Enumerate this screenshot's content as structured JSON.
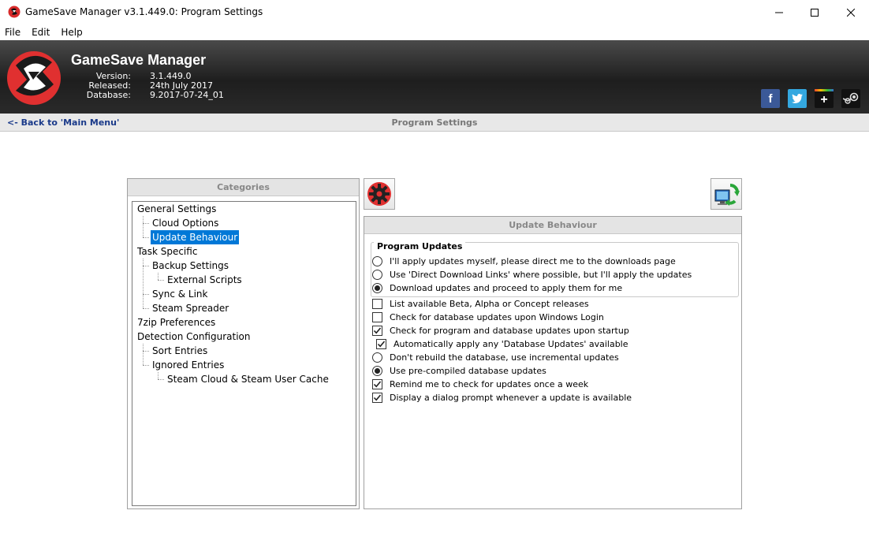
{
  "window": {
    "title": "GameSave Manager v3.1.449.0: Program Settings"
  },
  "menu": [
    "File",
    "Edit",
    "Help"
  ],
  "banner": {
    "app_name": "GameSave Manager",
    "labels": [
      "Version:",
      "Released:",
      "Database:"
    ],
    "values": [
      "3.1.449.0",
      "24th July 2017",
      "9.2017-07-24_01"
    ],
    "social": {
      "facebook": "f",
      "google_plus": "+"
    }
  },
  "nav": {
    "back_label": "<- Back to 'Main Menu'",
    "title": "Program Settings"
  },
  "categories": {
    "header": "Categories",
    "items": [
      "General Settings",
      "Cloud Options",
      "Update Behaviour",
      "Task Specific",
      "Backup Settings",
      "External Scripts",
      "Sync & Link",
      "Steam Spreader",
      "7zip Preferences",
      "Detection Configuration",
      "Sort Entries",
      "Ignored Entries",
      "Steam Cloud & Steam User Cache"
    ],
    "selected": "Update Behaviour"
  },
  "update_panel": {
    "header": "Update Behaviour",
    "group_title": "Program Updates",
    "radio_options": [
      {
        "label": "I'll apply updates myself, please direct me to the downloads page",
        "checked": false
      },
      {
        "label": "Use 'Direct Download Links' where possible, but I'll apply the updates",
        "checked": false
      },
      {
        "label": "Download updates and proceed to apply them for me",
        "checked": true
      }
    ],
    "options": [
      {
        "label": "List available Beta, Alpha or Concept releases",
        "kind": "checkbox",
        "checked": false
      },
      {
        "label": "Check for database updates upon Windows Login",
        "kind": "checkbox",
        "checked": false
      },
      {
        "label": "Check for program and database updates upon startup",
        "kind": "checkbox",
        "checked": true
      },
      {
        "label": "Automatically apply any 'Database Updates' available",
        "kind": "checkbox",
        "checked": true
      },
      {
        "label": "Don't rebuild the database, use incremental updates",
        "kind": "radio",
        "checked": false
      },
      {
        "label": "Use pre-compiled database updates",
        "kind": "radio",
        "checked": true
      },
      {
        "label": "Remind me to check for updates once a week",
        "kind": "checkbox",
        "checked": true
      },
      {
        "label": "Display a dialog prompt whenever a update is available",
        "kind": "checkbox",
        "checked": true
      }
    ]
  },
  "colors": {
    "selection": "#0078d7",
    "link": "#1a3a8a",
    "brand_red": "#e03030"
  }
}
